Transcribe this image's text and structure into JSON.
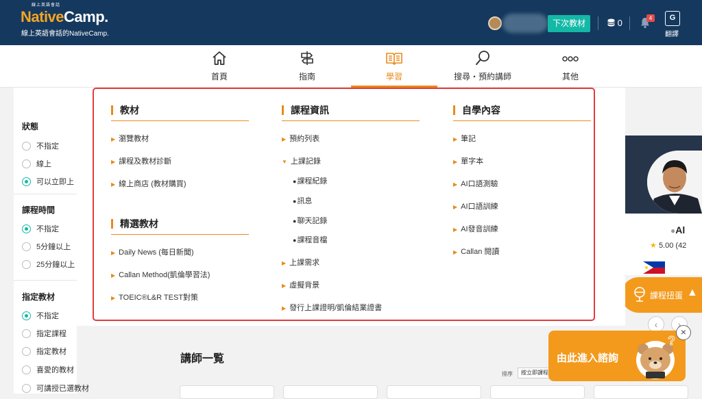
{
  "header": {
    "logo_small": "線上英語會話",
    "logo_native": "Native",
    "logo_camp": "Camp.",
    "logo_subtitle": "線上英語會話的NativeCamp.",
    "next_material_label": "下次教材",
    "coins": "0",
    "notification_count": "4",
    "translate_label": "翻譯"
  },
  "nav": {
    "items": [
      {
        "label": "首頁",
        "icon": "home-icon"
      },
      {
        "label": "指南",
        "icon": "signpost-icon"
      },
      {
        "label": "學習",
        "icon": "book-icon"
      },
      {
        "label": "搜尋・預約講師",
        "icon": "search-icon"
      },
      {
        "label": "其他",
        "icon": "more-icon"
      }
    ],
    "active_color": "#e88a1a"
  },
  "sidebar": {
    "status": {
      "heading": "狀態",
      "options": [
        "不指定",
        "線上",
        "可以立即上"
      ]
    },
    "duration": {
      "heading": "課程時間",
      "options": [
        "不指定",
        "5分鐘以上",
        "25分鐘以上"
      ]
    },
    "material": {
      "heading": "指定教材",
      "options": [
        "不指定",
        "指定課程",
        "指定教材",
        "喜愛的教材",
        "可講授已選教材"
      ]
    }
  },
  "menu": {
    "col1": {
      "heading": "教材",
      "items": [
        "瀏覽教材",
        "課程及教材診斷",
        "線上商店 (教材購買)"
      ],
      "heading2": "精選教材",
      "items2": [
        "Daily News (每日新聞)",
        "Callan Method(凱倫學習法)",
        "TOEIC®L&R TEST對策"
      ]
    },
    "col2": {
      "heading": "課程資訊",
      "item_reserve": "預約列表",
      "item_record": "上課記錄",
      "sub_items": [
        "課程紀錄",
        "訊息",
        "聊天記錄",
        "課程音檔"
      ],
      "items_after": [
        "上課需求",
        "虛擬背景",
        "發行上課證明/凱倫結業證書"
      ]
    },
    "col3": {
      "heading": "自學內容",
      "items": [
        "筆記",
        "單字本",
        "AI口語測驗",
        "AI口語訓練",
        "AI發音訓練",
        "Callan 閱讀"
      ]
    }
  },
  "main": {
    "teacher_list_title": "講師一覧",
    "sort_label": "排序",
    "sort_value": "按立即課程"
  },
  "teacher": {
    "name": "Al",
    "rating": "5.00 (42"
  },
  "gacha_label": "課程扭蛋",
  "consult_label": "由此進入諮詢"
}
